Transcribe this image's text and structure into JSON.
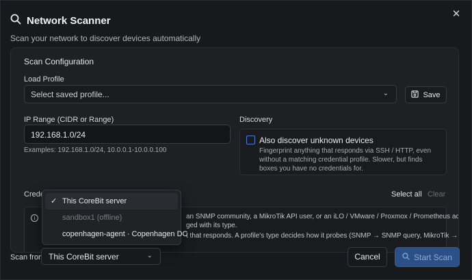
{
  "dialog": {
    "title": "Network Scanner",
    "subtitle": "Scan your network to discover devices automatically",
    "close_label": "✕"
  },
  "scan_config": {
    "section_title": "Scan Configuration",
    "load_profile_label": "Load Profile",
    "load_profile_placeholder": "Select saved profile...",
    "save_label": "Save",
    "ip_range_label": "IP Range (CIDR or Range)",
    "ip_range_value": "192.168.1.0/24",
    "ip_range_examples": "Examples: 192.168.1.0/24, 10.0.0.1-10.0.0.100",
    "discovery_label": "Discovery",
    "discovery_checkbox_title": "Also discover unknown devices",
    "discovery_checkbox_desc": "Fingerprint anything that responds via SSH / HTTP, even without a matching credential profile. Slower, but finds boxes you have no credentials for.",
    "discovery_checked": false,
    "credentials_label_visible": "Creden",
    "select_all_label": "Select all",
    "clear_label": "Clear",
    "info_lines": [
      "an SNMP community, a MikroTik API user, or an iLO / VMware / Proxmox / Prometheus account —",
      "ged with its type.",
      "t that responds. A profile's type decides how it probes (SNMP → SNMP query, MikroTik →"
    ]
  },
  "scan_from_dropdown": {
    "items": [
      {
        "label": "This CoreBit server",
        "selected": true,
        "disabled": false
      },
      {
        "label": "sandbox1 (offline)",
        "selected": false,
        "disabled": true
      },
      {
        "label": "copenhagen-agent · Copenhagen DC",
        "selected": false,
        "disabled": false
      }
    ]
  },
  "footer": {
    "scan_from_label": "Scan from",
    "scan_from_value": "This CoreBit server",
    "cancel_label": "Cancel",
    "start_scan_label": "Start Scan"
  },
  "colors": {
    "accent": "#2b4f87",
    "checkbox_border": "#4d7fd8",
    "background": "#18191c"
  }
}
